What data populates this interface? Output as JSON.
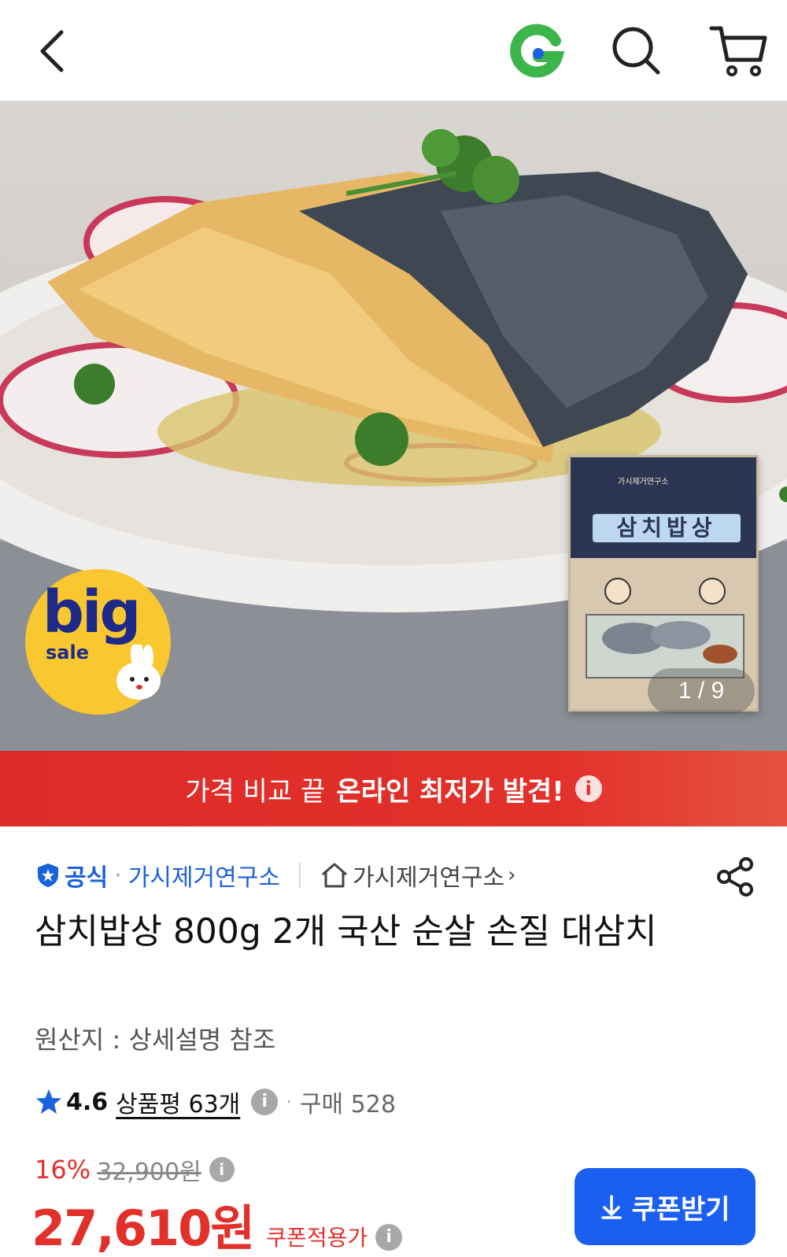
{
  "header": {
    "back_icon": "chevron-left-icon",
    "brand_icon": "gmarket-g-icon",
    "search_icon": "search-icon",
    "cart_icon": "cart-icon"
  },
  "hero": {
    "badge": {
      "big": "big",
      "sale": "sale"
    },
    "package": {
      "title": "삼치밥상",
      "brand": "가시제거연구소"
    },
    "page_indicator": "1 / 9"
  },
  "banner": {
    "text_normal": "가격 비교 끝",
    "text_bold": "온라인 최저가 발견!",
    "info": "i"
  },
  "seller": {
    "official_label": "공식",
    "dot": "·",
    "shop_name": "가시제거연구소",
    "store_link": "가시제거연구소",
    "chevron": "›"
  },
  "product": {
    "title": "삼치밥상 800g 2개 국산 순살 손질 대삼치",
    "origin": "원산지 : 상세설명 참조"
  },
  "rating": {
    "score": "4.6",
    "reviews": "상품평 63개",
    "dot": "·",
    "sold": "구매 528"
  },
  "price": {
    "discount": "16%",
    "original": "32,900원",
    "final": "27,610원",
    "final_label": "쿠폰적용가",
    "info": "i"
  },
  "coupon_button": {
    "label": "쿠폰받기"
  },
  "colors": {
    "accent_red": "#e2302a",
    "brand_blue": "#1a62dd",
    "button_blue": "#1a5ff0",
    "g_green": "#3cb54a"
  }
}
